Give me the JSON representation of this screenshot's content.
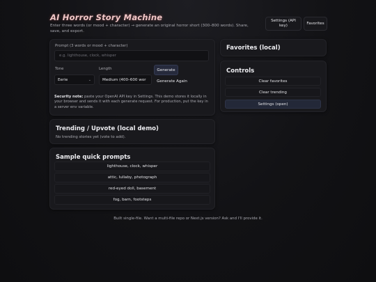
{
  "header": {
    "title": "AI Horror Story Machine",
    "subtitle": "Enter three words (or mood + character) → generate an original horror short (300–800 words). Share, save, and export.",
    "settings_button": "Settings (API key)",
    "favorites_button": "Favorites"
  },
  "prompt_card": {
    "prompt_label": "Prompt (3 words or mood + character)",
    "prompt_placeholder": "e.g. lighthouse, clock, whisper",
    "tone_label": "Tone",
    "tone_value": "Eerie",
    "length_label": "Length",
    "length_value": "Medium (400–600 wor",
    "generate_button": "Generate",
    "generate_again_button": "Generate Again",
    "security_title": "Security note:",
    "security_text": " paste your OpenAI API key in Settings. This demo stores it locally in your browser and sends it with each generate request. For production, put the key in a server env variable."
  },
  "trending_card": {
    "title": "Trending / Upvote (local demo)",
    "empty_text": "No trending stories yet (vote to add)."
  },
  "samples_card": {
    "title": "Sample quick prompts",
    "items": [
      {
        "label": "lighthouse, clock, whisper"
      },
      {
        "label": "attic, lullaby, photograph"
      },
      {
        "label": "red-eyed doll, basement"
      },
      {
        "label": "fog, barn, footsteps"
      }
    ]
  },
  "favorites_card": {
    "title": "Favorites (local)"
  },
  "controls_card": {
    "title": "Controls",
    "clear_favorites": "Clear favorites",
    "clear_trending": "Clear trending",
    "settings_open": "Settings (open)"
  },
  "footer": {
    "text": "Built single-file. Want a multi-file repo or Next.js version? Ask and I'll provide it."
  },
  "colors": {
    "accent_button": "#2a2f44",
    "active_row": "#232838",
    "title_glow": "#f0c7c7"
  }
}
